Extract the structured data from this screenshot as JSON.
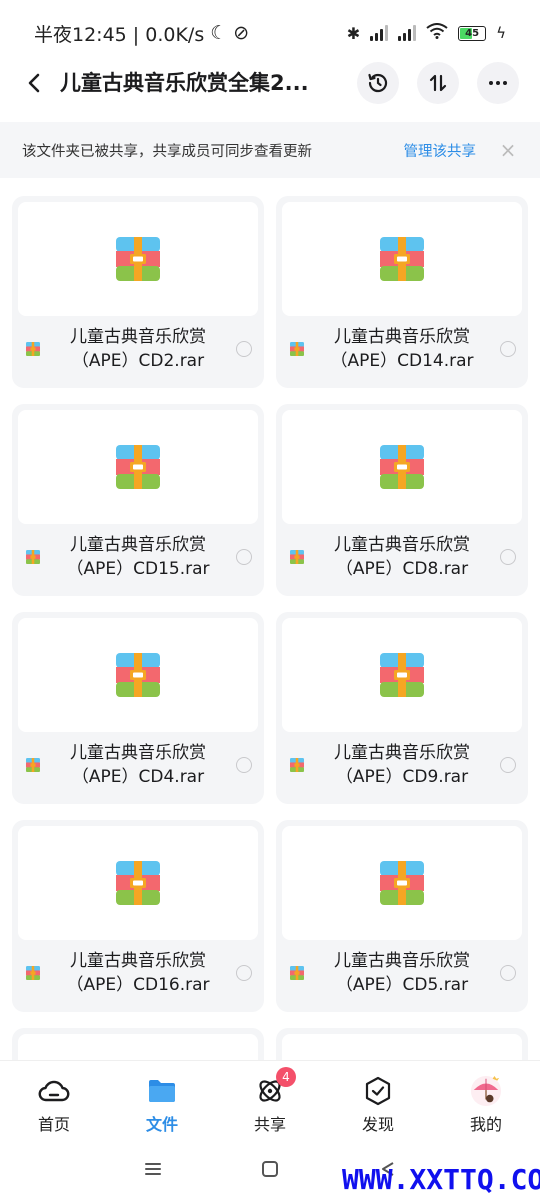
{
  "status_bar": {
    "time": "半夜12:45 | 0.0K/s",
    "battery": "45"
  },
  "header": {
    "title": "儿童古典音乐欣赏全集2..."
  },
  "banner": {
    "message": "该文件夹已被共享，共享成员可同步查看更新",
    "manage_label": "管理该共享",
    "close_label": "×"
  },
  "files": [
    {
      "line1": "儿童古典音乐欣赏",
      "line2": "（APE）CD2.rar"
    },
    {
      "line1": "儿童古典音乐欣赏",
      "line2": "（APE）CD14.rar"
    },
    {
      "line1": "儿童古典音乐欣赏",
      "line2": "（APE）CD15.rar"
    },
    {
      "line1": "儿童古典音乐欣赏",
      "line2": "（APE）CD8.rar"
    },
    {
      "line1": "儿童古典音乐欣赏",
      "line2": "（APE）CD4.rar"
    },
    {
      "line1": "儿童古典音乐欣赏",
      "line2": "（APE）CD9.rar"
    },
    {
      "line1": "儿童古典音乐欣赏",
      "line2": "（APE）CD16.rar"
    },
    {
      "line1": "儿童古典音乐欣赏",
      "line2": "（APE）CD5.rar"
    },
    {
      "line1": "",
      "line2": ""
    },
    {
      "line1": "",
      "line2": ""
    }
  ],
  "tabs": [
    {
      "label": "首页",
      "icon": "home-cloud-icon"
    },
    {
      "label": "文件",
      "icon": "folder-icon"
    },
    {
      "label": "共享",
      "icon": "share-atom-icon",
      "badge": "4"
    },
    {
      "label": "发现",
      "icon": "discover-cube-icon"
    },
    {
      "label": "我的",
      "icon": "avatar-icon"
    }
  ],
  "watermark": "WWW.XXTTQ.COM",
  "colors": {
    "accent": "#2d8de6",
    "badge": "#f4506a",
    "archive_blue": "#5ec3ef",
    "archive_red": "#f3686e",
    "archive_green": "#8bc34a",
    "archive_band": "#f5a623"
  }
}
